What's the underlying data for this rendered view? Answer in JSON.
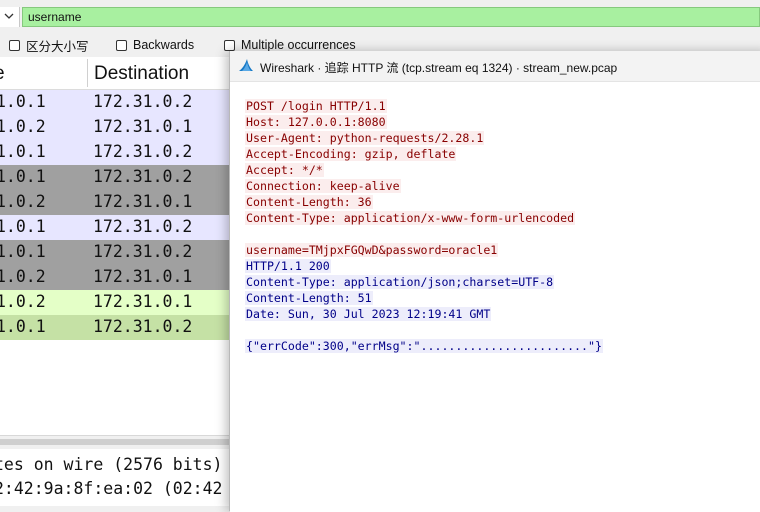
{
  "search": {
    "value": "username",
    "options": [
      {
        "label": "区分大小写",
        "checked": false
      },
      {
        "label": "Backwards",
        "checked": false
      },
      {
        "label": "Multiple occurrences",
        "checked": false
      }
    ]
  },
  "packet_list": {
    "columns": {
      "source": "e",
      "destination": "Destination"
    },
    "rows": [
      {
        "src": "1.0.1",
        "dst": "172.31.0.2",
        "color": "#e7e6ff"
      },
      {
        "src": "1.0.2",
        "dst": "172.31.0.1",
        "color": "#e7e6ff"
      },
      {
        "src": "1.0.1",
        "dst": "172.31.0.2",
        "color": "#e7e6ff"
      },
      {
        "src": "1.0.1",
        "dst": "172.31.0.2",
        "color": "#a0a0a0"
      },
      {
        "src": "1.0.2",
        "dst": "172.31.0.1",
        "color": "#a0a0a0"
      },
      {
        "src": "1.0.1",
        "dst": "172.31.0.2",
        "color": "#e7e6ff"
      },
      {
        "src": "1.0.1",
        "dst": "172.31.0.2",
        "color": "#a0a0a0"
      },
      {
        "src": "1.0.2",
        "dst": "172.31.0.1",
        "color": "#a0a0a0"
      },
      {
        "src": "1.0.2",
        "dst": "172.31.0.1",
        "color": "#e4ffc7"
      },
      {
        "src": "1.0.1",
        "dst": "172.31.0.2",
        "color": "#c5e1a5"
      }
    ]
  },
  "details": {
    "line1": "tes on wire (2576 bits)",
    "line2": "2:42:9a:8f:ea:02 (02:42"
  },
  "dialog": {
    "title": "Wireshark · 追踪 HTTP 流 (tcp.stream eq 1324) · stream_new.pcap",
    "request": [
      "POST /login HTTP/1.1",
      "Host: 127.0.0.1:8080",
      "User-Agent: python-requests/2.28.1",
      "Accept-Encoding: gzip, deflate",
      "Accept: */*",
      "Connection: keep-alive",
      "Content-Length: 36",
      "Content-Type: application/x-www-form-urlencoded",
      "",
      "username=TMjpxFGQwD&password=oracle1"
    ],
    "response": [
      "HTTP/1.1 200",
      "Content-Type: application/json;charset=UTF-8",
      "Content-Length: 51",
      "Date: Sun, 30 Jul 2023 12:19:41 GMT",
      "",
      "{\"errCode\":300,\"errMsg\":\"........................\"}"
    ]
  }
}
